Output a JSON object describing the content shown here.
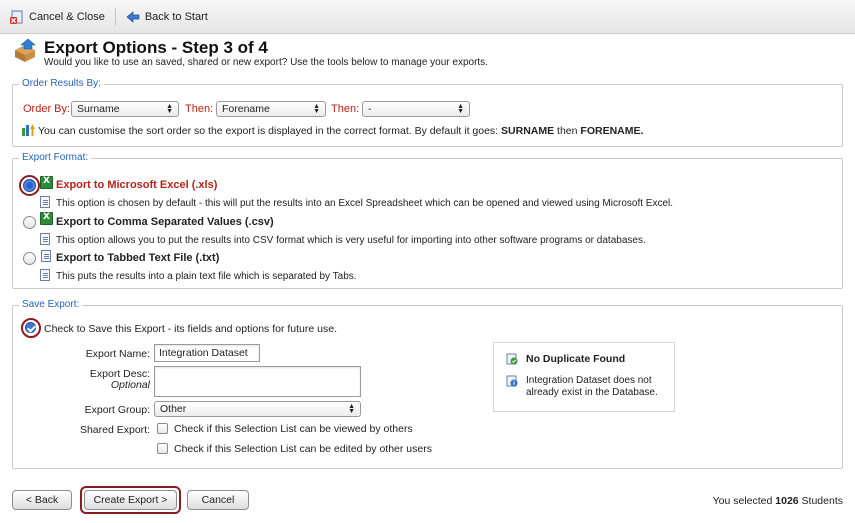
{
  "toolbar": {
    "cancel_close_label": "Cancel & Close",
    "back_to_start_label": "Back to Start"
  },
  "header": {
    "title": "Export Options - Step 3 of 4",
    "subtitle": "Would you like to use an saved, shared or new export? Use the tools below to manage your exports."
  },
  "order_results": {
    "legend": "Order Results By:",
    "order_by_label": "Order By:",
    "order_by_value": "Surname",
    "then1_label": "Then:",
    "then1_value": "Forename",
    "then2_label": "Then:",
    "then2_value": "-",
    "info_text": "You can customise the sort order so the export is displayed in the correct format. By default it goes:",
    "info_first": "SURNAME",
    "info_then": "then",
    "info_second": "FORENAME."
  },
  "export_format": {
    "legend": "Export Format:",
    "options": [
      {
        "title": "Export to Microsoft Excel (.xls)",
        "desc": "This option is chosen by default - this will put the results into an Excel Spreadsheet which can be opened and viewed using Microsoft Excel.",
        "selected": true
      },
      {
        "title": "Export to Comma Separated Values (.csv)",
        "desc": "This option allows you to put the results into CSV format which is very useful for importing into other software programs or databases.",
        "selected": false
      },
      {
        "title": "Export to Tabbed Text File (.txt)",
        "desc": "This puts the results into a plain text file which is separated by Tabs.",
        "selected": false
      }
    ]
  },
  "save_export": {
    "legend": "Save Export:",
    "save_check_label": "Check to Save this Export - its fields and options for future use.",
    "save_checked": true,
    "name_label": "Export Name:",
    "name_value": "Integration Dataset",
    "desc_label": "Export Desc:",
    "desc_optional": "Optional",
    "desc_value": "",
    "group_label": "Export Group:",
    "group_value": "Other",
    "shared_label": "Shared Export:",
    "shared_view_label": "Check if this Selection List can be viewed by others",
    "shared_edit_label": "Check if this Selection List can be edited by other users",
    "status_title": "No Duplicate Found",
    "status_text": "Integration Dataset does not already exist in the Database."
  },
  "footer": {
    "back_label": "< Back",
    "create_label": "Create Export >",
    "cancel_label": "Cancel",
    "selected_prefix": "You selected",
    "selected_count": "1026",
    "selected_suffix": "Students"
  },
  "colors": {
    "accent_blue": "#2a62b5",
    "label_red": "#b7221a",
    "highlight_ring": "#8b1b20"
  }
}
